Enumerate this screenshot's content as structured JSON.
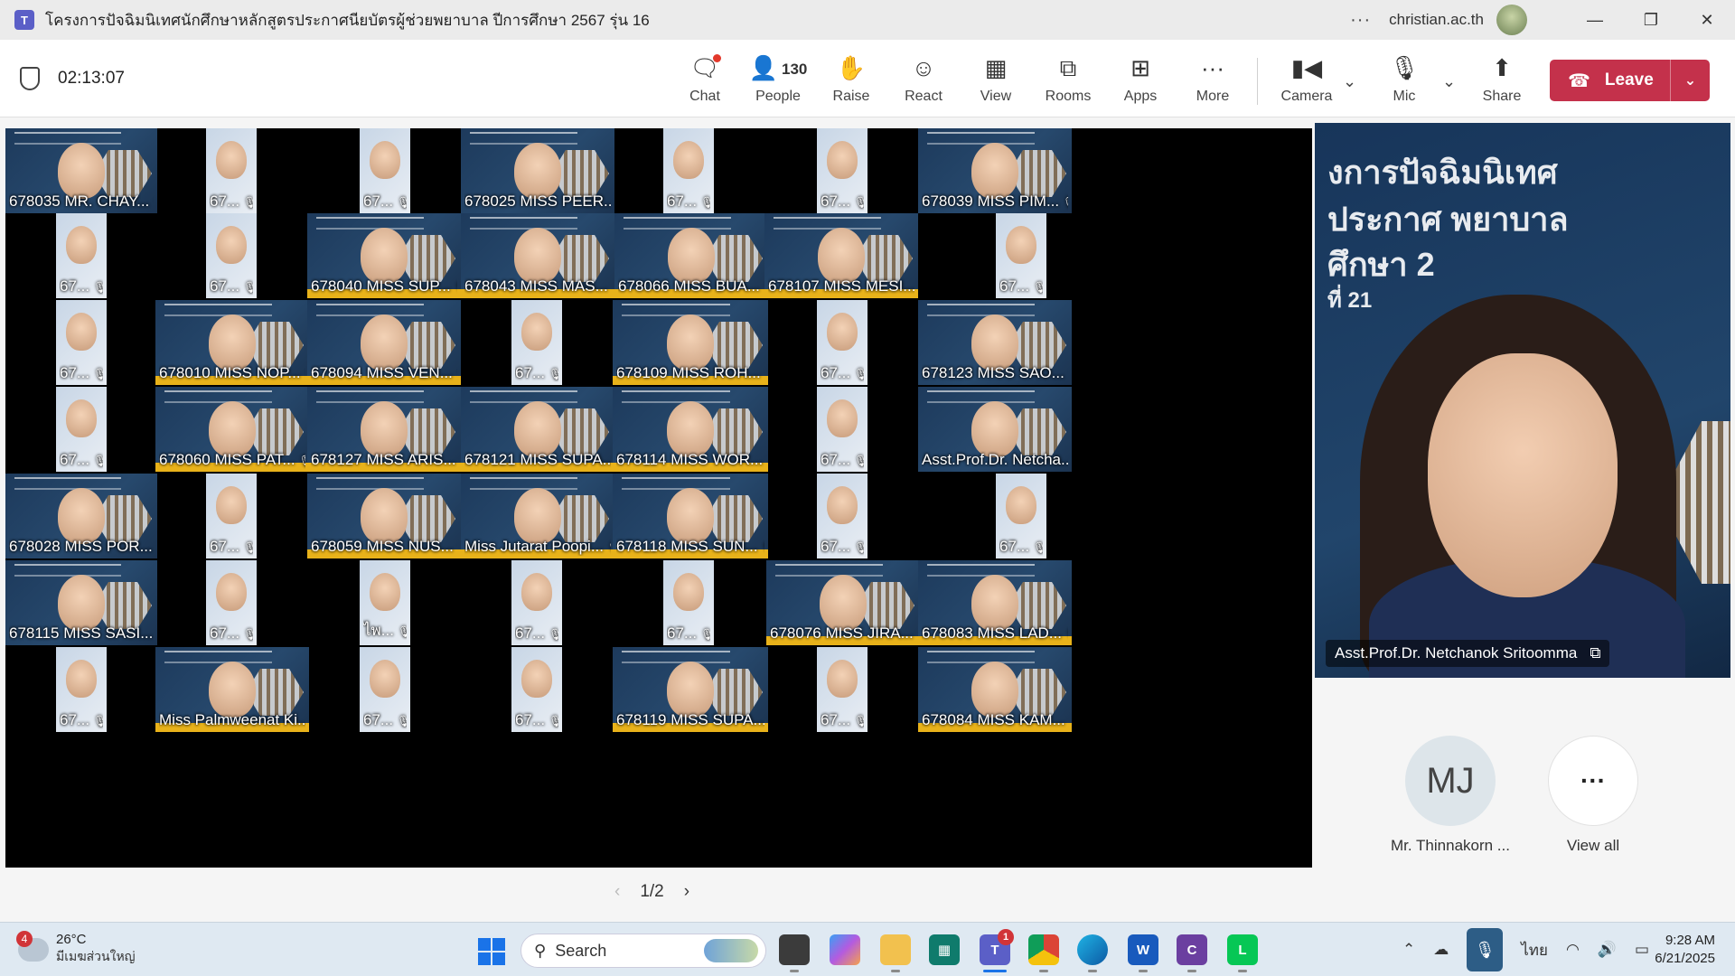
{
  "titlebar": {
    "app_icon": "teams-icon",
    "meeting_title": "โครงการปัจฉิมนิเทศนักศึกษาหลักสูตรประกาศนียบัตรผู้ช่วยพยาบาล ปีการศึกษา 2567 รุ่น 16",
    "more": "···",
    "account": "christian.ac.th",
    "minimize": "—",
    "restore": "❐",
    "close": "✕"
  },
  "toolbar": {
    "timer": "02:13:07",
    "buttons": {
      "chat": "Chat",
      "people": "People",
      "people_count": "130",
      "raise": "Raise",
      "react": "React",
      "view": "View",
      "rooms": "Rooms",
      "apps": "Apps",
      "more": "More",
      "camera": "Camera",
      "mic": "Mic",
      "share": "Share"
    },
    "leave": "Leave"
  },
  "tiles": [
    "678035 MR. CHAY...",
    "67...",
    "67...",
    "678025 MISS PEER...",
    "67...",
    "67...",
    "678039 MISS PIM...",
    "67...",
    "67...",
    "678040 MISS SUP...",
    "678043 MISS MAS...",
    "678066 MISS BUA...",
    "678107 MISS MESI...",
    "67...",
    "67...",
    "678010 MISS NOP...",
    "678094 MISS VEN...",
    "67...",
    "678109 MISS ROH...",
    "67...",
    "678123 MISS SAO...",
    "67...",
    "678060 MISS PAT...",
    "678127 MISS ARIS...",
    "678121 MISS SUPA...",
    "678114 MISS WOR...",
    "67...",
    "Asst.Prof.Dr. Netcha...",
    "678028 MISS POR...",
    "67...",
    "678059 MISS NUS...",
    "Miss Jutarat Poopi...",
    "678118 MISS SUN...",
    "67...",
    "67...",
    "678115 MISS SASI...",
    "67...",
    "ไพ...",
    "67...",
    "67...",
    "678076 MISS JIRA...",
    "678083 MISS LAD...",
    "67...",
    "Miss Palmweenat Ki...",
    "67...",
    "67...",
    "678119 MISS SUPA...",
    "67...",
    "678084 MISS KAM..."
  ],
  "spotlight": {
    "name": "Asst.Prof.Dr. Netchanok Sritoomma",
    "backdrop_lines": [
      "งการปัจฉิมนิเทศ",
      "ประกาศ           พยาบาล",
      "ศึกษา 2",
      "ที่ 21"
    ]
  },
  "side": {
    "mj_initials": "MJ",
    "mj_name": "Mr. Thinnakorn ...",
    "viewall_symbol": "···",
    "viewall_label": "View all"
  },
  "pager": {
    "prev": "‹",
    "page": "1/2",
    "next": "›"
  },
  "taskbar": {
    "weather_badge": "4",
    "temp": "26°C",
    "condition": "มีเมฆส่วนใหญ่",
    "search": "Search",
    "teams_badge": "1",
    "language": "ไทย",
    "time": "9:28 AM",
    "date": "6/21/2025"
  },
  "colors": {
    "leave_red": "#c4314b",
    "teams_purple": "#5b5fc7",
    "tile_bg": "#1d3a5c",
    "tile_accent_yellow": "#e8b21a"
  }
}
